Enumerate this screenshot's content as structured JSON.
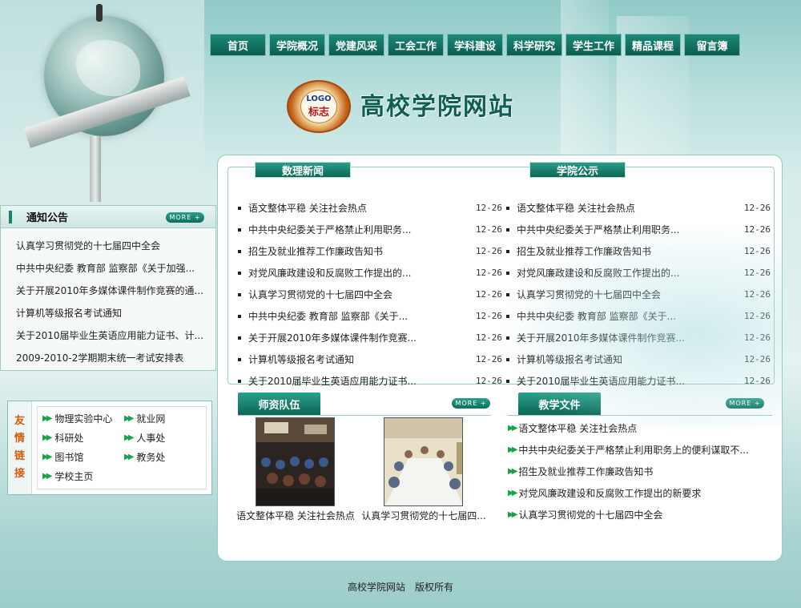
{
  "nav": [
    "首页",
    "学院概况",
    "党建风采",
    "工会工作",
    "学科建设",
    "科学研究",
    "学生工作",
    "精品课程",
    "留言簿"
  ],
  "logo": {
    "line1": "LOGO",
    "line2": "标志"
  },
  "site_title": "高校学院网站",
  "notice": {
    "title": "通知公告",
    "more": "MORE +",
    "items": [
      "认真学习贯彻党的十七届四中全会",
      "中共中央纪委 教育部 监察部《关于加强...",
      "关于开展2010年多媒体课件制作竞赛的通...",
      "计算机等级报名考试通知",
      "关于2010届毕业生英语应用能力证书、计...",
      "2009-2010-2学期期末统一考试安排表"
    ]
  },
  "links": {
    "label": [
      "友",
      "情",
      "链",
      "接"
    ],
    "items": [
      "物理实验中心",
      "就业网",
      "科研处",
      "人事处",
      "图书馆",
      "教务处",
      "学校主页"
    ]
  },
  "news_left": {
    "title": "数理新闻",
    "items": [
      {
        "text": "语文整体平稳 关注社会热点",
        "date": "12-26"
      },
      {
        "text": "中共中央纪委关于严格禁止利用职务...",
        "date": "12-26"
      },
      {
        "text": "招生及就业推荐工作廉政告知书",
        "date": "12-26"
      },
      {
        "text": "对党风廉政建设和反腐败工作提出的...",
        "date": "12-26"
      },
      {
        "text": "认真学习贯彻党的十七届四中全会",
        "date": "12-26"
      },
      {
        "text": "中共中央纪委 教育部 监察部《关于...",
        "date": "12-26"
      },
      {
        "text": "关于开展2010年多媒体课件制作竞赛...",
        "date": "12-26"
      },
      {
        "text": "计算机等级报名考试通知",
        "date": "12-26"
      },
      {
        "text": "关于2010届毕业生英语应用能力证书...",
        "date": "12-26"
      }
    ]
  },
  "news_right": {
    "title": "学院公示",
    "items": [
      {
        "text": "语文整体平稳 关注社会热点",
        "date": "12-26"
      },
      {
        "text": "中共中央纪委关于严格禁止利用职务...",
        "date": "12-26"
      },
      {
        "text": "招生及就业推荐工作廉政告知书",
        "date": "12-26"
      },
      {
        "text": "对党风廉政建设和反腐败工作提出的...",
        "date": "12-26"
      },
      {
        "text": "认真学习贯彻党的十七届四中全会",
        "date": "12-26"
      },
      {
        "text": "中共中央纪委 教育部 监察部《关于...",
        "date": "12-26"
      },
      {
        "text": "关于开展2010年多媒体课件制作竞赛...",
        "date": "12-26"
      },
      {
        "text": "计算机等级报名考试通知",
        "date": "12-26"
      },
      {
        "text": "关于2010届毕业生英语应用能力证书...",
        "date": "12-26"
      }
    ]
  },
  "teachers": {
    "title": "师资队伍",
    "more": "MORE +",
    "photos": [
      {
        "caption": "语文整体平稳 关注社会热点"
      },
      {
        "caption": "认真学习贯彻党的十七届四..."
      }
    ]
  },
  "docs": {
    "title": "教学文件",
    "more": "MORE +",
    "items": [
      "语文整体平稳 关注社会热点",
      "中共中央纪委关于严格禁止利用职务上的便利谋取不...",
      "招生及就业推荐工作廉政告知书",
      "对党风廉政建设和反腐败工作提出的新要求",
      "认真学习贯彻党的十七届四中全会"
    ]
  },
  "footer": {
    "site": "高校学院网站",
    "rights": "版权所有"
  }
}
